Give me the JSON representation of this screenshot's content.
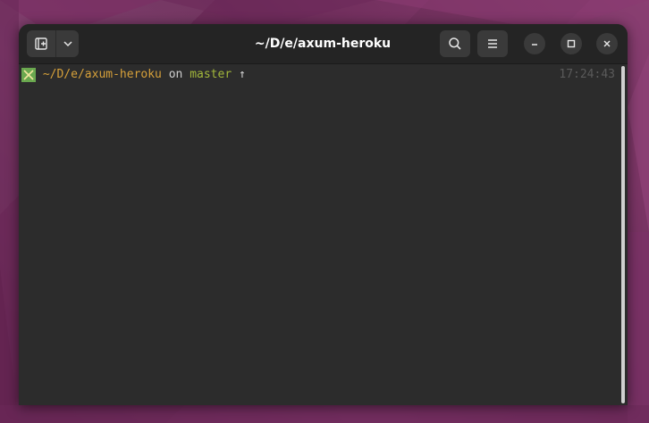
{
  "window": {
    "title": "~/D/e/axum-heroku"
  },
  "toolbar": {
    "new_tab_icon": "new-tab-icon",
    "dropdown_icon": "chevron-down-icon",
    "search_icon": "search-icon",
    "menu_icon": "hamburger-menu-icon",
    "minimize_icon": "minimize-icon",
    "maximize_icon": "maximize-icon",
    "close_icon": "close-icon"
  },
  "terminal": {
    "prompt": {
      "status_icon": "cross-status-icon",
      "path": "~/D/e/axum-heroku",
      "connector": "on",
      "branch": "master",
      "ahead_symbol": "↑",
      "time": "17:24:43"
    }
  },
  "colors": {
    "path": "#d7a13a",
    "branch": "#a3b83b",
    "status_icon_bg": "#6aa84f",
    "terminal_bg": "#2c2c2c",
    "headerbar_bg": "#242424"
  }
}
